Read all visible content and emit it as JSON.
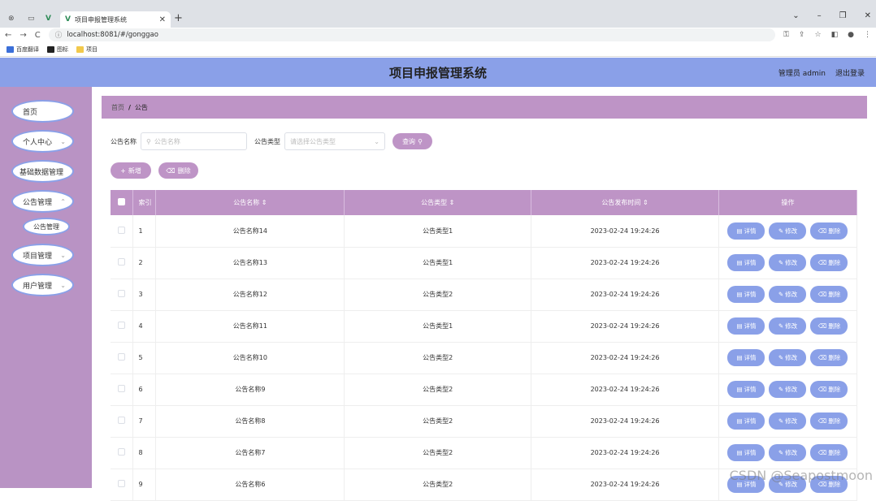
{
  "browser": {
    "tab_title": "项目申报管理系统",
    "url": "localhost:8081/#/gonggao",
    "bookmarks": [
      "百度翻译",
      "图标",
      "项目"
    ]
  },
  "header": {
    "title": "项目申报管理系统",
    "user": "管理员 admin",
    "logout": "退出登录",
    "bg_color": "#8aa0e8"
  },
  "sidebar": {
    "bg_color": "#b993c4",
    "items": [
      {
        "label": "首页"
      },
      {
        "label": "个人中心"
      },
      {
        "label": "基础数据管理"
      },
      {
        "label": "公告管理"
      },
      {
        "label": "公告管理"
      },
      {
        "label": "项目管理"
      },
      {
        "label": "用户管理"
      }
    ]
  },
  "breadcrumb": {
    "home": "首页",
    "sep": "/",
    "current": "公告"
  },
  "search": {
    "name_label": "公告名称",
    "name_placeholder": "公告名称",
    "type_label": "公告类型",
    "type_placeholder": "请选择公告类型",
    "query_button": "查询"
  },
  "actions": {
    "add": "新增",
    "delete": "删除"
  },
  "table": {
    "header_color": "#be94c6",
    "columns": [
      "索引",
      "公告名称 ⇕",
      "公告类型 ⇕",
      "公告发布时间 ⇕",
      "操作"
    ],
    "ops": {
      "detail": "详情",
      "edit": "修改",
      "delete": "删除"
    },
    "rows": [
      {
        "idx": "1",
        "name": "公告名称14",
        "type": "公告类型1",
        "time": "2023-02-24 19:24:26"
      },
      {
        "idx": "2",
        "name": "公告名称13",
        "type": "公告类型1",
        "time": "2023-02-24 19:24:26"
      },
      {
        "idx": "3",
        "name": "公告名称12",
        "type": "公告类型2",
        "time": "2023-02-24 19:24:26"
      },
      {
        "idx": "4",
        "name": "公告名称11",
        "type": "公告类型1",
        "time": "2023-02-24 19:24:26"
      },
      {
        "idx": "5",
        "name": "公告名称10",
        "type": "公告类型2",
        "time": "2023-02-24 19:24:26"
      },
      {
        "idx": "6",
        "name": "公告名称9",
        "type": "公告类型2",
        "time": "2023-02-24 19:24:26"
      },
      {
        "idx": "7",
        "name": "公告名称8",
        "type": "公告类型2",
        "time": "2023-02-24 19:24:26"
      },
      {
        "idx": "8",
        "name": "公告名称7",
        "type": "公告类型2",
        "time": "2023-02-24 19:24:26"
      },
      {
        "idx": "9",
        "name": "公告名称6",
        "type": "公告类型2",
        "time": "2023-02-24 19:24:26"
      }
    ]
  },
  "watermark": "CSDN @Seapostmoon"
}
